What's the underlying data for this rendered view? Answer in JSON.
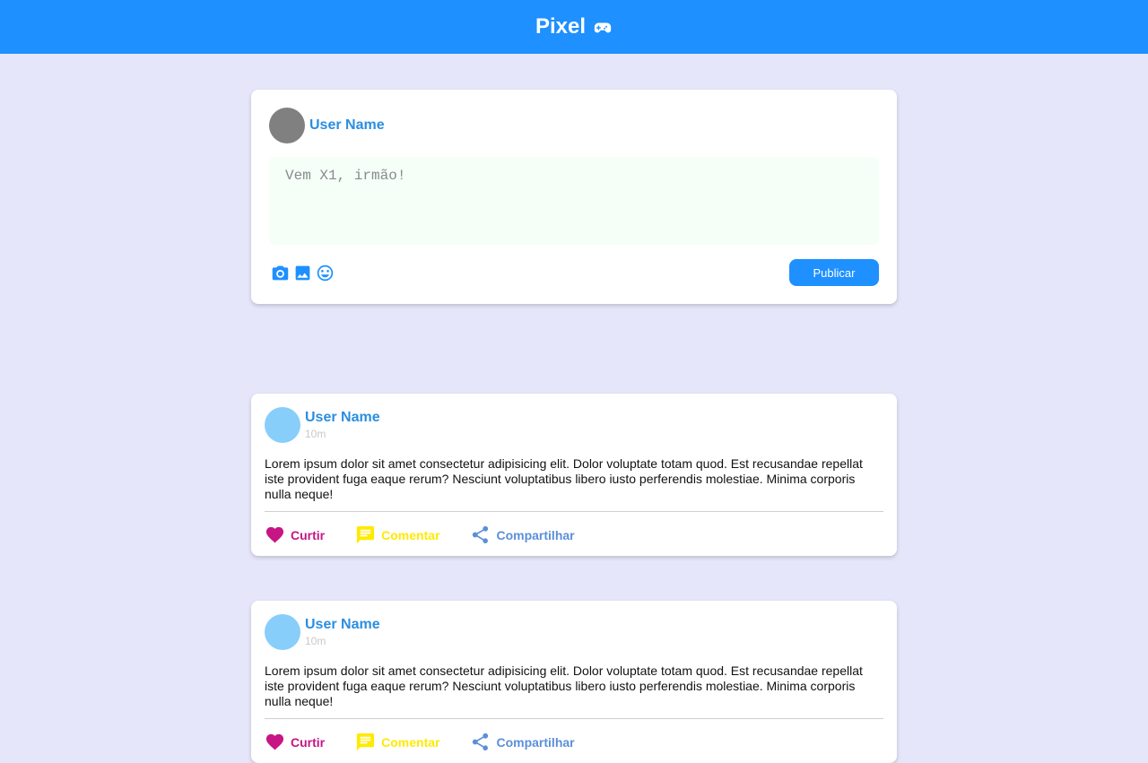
{
  "header": {
    "brand": "Pixel",
    "brand_icon": "gamepad-icon",
    "color": "#1e90ff"
  },
  "composer": {
    "user_name": "User Name",
    "placeholder": "Vem X1, irmão!",
    "icons": [
      "camera-icon",
      "image-icon",
      "emoji-icon"
    ],
    "publish_label": "Publicar"
  },
  "posts": [
    {
      "user_name": "User Name",
      "time": "10m",
      "content": "Lorem ipsum dolor sit amet consectetur adipisicing elit. Dolor voluptate totam quod. Est recusandae repellat iste provident fuga eaque rerum? Nesciunt voluptatibus libero iusto perferendis molestiae. Minima corporis nulla neque!",
      "like_label": "Curtir",
      "comment_label": "Comentar",
      "share_label": "Compartilhar"
    },
    {
      "user_name": "User Name",
      "time": "10m",
      "content": "Lorem ipsum dolor sit amet consectetur adipisicing elit. Dolor voluptate totam quod. Est recusandae repellat iste provident fuga eaque rerum? Nesciunt voluptatibus libero iusto perferendis molestiae. Minima corporis nulla neque!",
      "like_label": "Curtir",
      "comment_label": "Comentar",
      "share_label": "Compartilhar"
    }
  ],
  "colors": {
    "background": "#e6e6fa",
    "accent": "#1e90ff",
    "like": "#c71585",
    "comment": "#ffea00",
    "share": "#5b8fd9"
  }
}
